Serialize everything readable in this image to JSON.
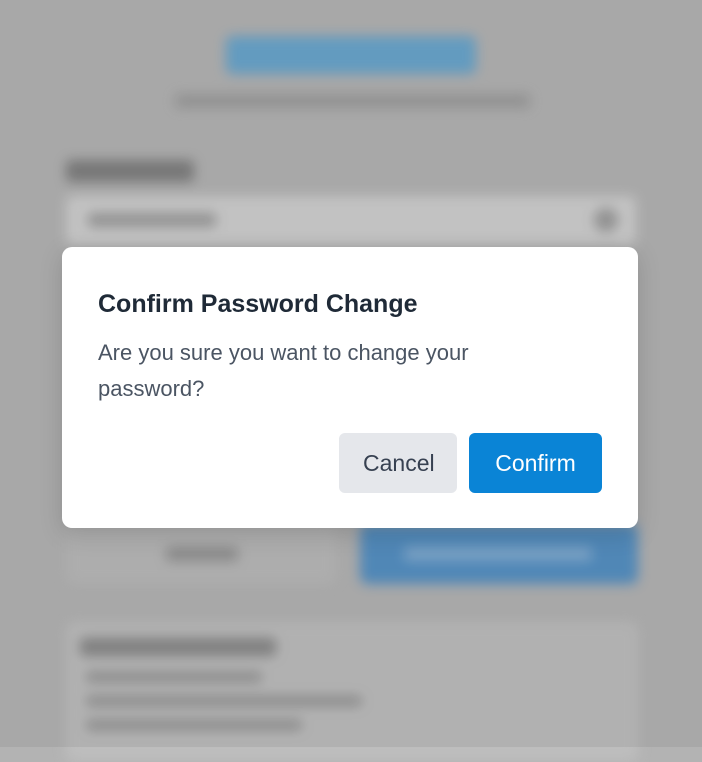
{
  "modal": {
    "title": "Confirm Password Change",
    "message": "Are you sure you want to change your password?",
    "cancel_label": "Cancel",
    "confirm_label": "Confirm"
  },
  "colors": {
    "confirm_button": "#0a84d6",
    "cancel_button": "#e5e7eb",
    "backdrop": "#b3b3b3"
  }
}
